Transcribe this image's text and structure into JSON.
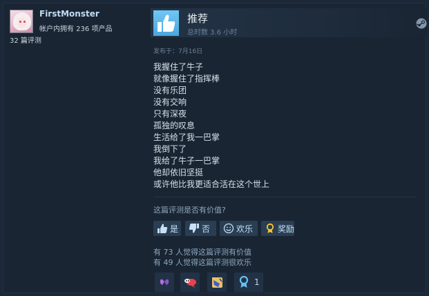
{
  "user": {
    "name": "FirstMonster",
    "products_owned": "帐户内拥有 236 项产品",
    "review_count": "32 篇评测"
  },
  "review": {
    "verdict": "推荐",
    "hours": "总时数 3.6 小时",
    "posted": "发布于：7月16日",
    "lines": [
      "我握住了牛子",
      "就像握住了指挥棒",
      "没有乐团",
      "没有交响",
      "只有深夜",
      "孤独的叹息",
      "生活给了我一巴掌",
      "我倒下了",
      "我给了牛子一巴掌",
      "他却依旧坚挺",
      "或许他比我更适合活在这个世上"
    ],
    "helpful_question": "这篇评测是否有价值?",
    "buttons": {
      "yes": "是",
      "no": "否",
      "funny": "欢乐",
      "award": "奖励"
    },
    "helpful_stat": "有 73 人觉得这篇评测有价值",
    "funny_stat": "有 49 人觉得这篇评测很欢乐",
    "award_count": "1"
  },
  "icons": {
    "verdict": "thumbs-up-icon",
    "platform": "steam-logo-icon",
    "yes": "thumbs-up-icon",
    "no": "thumbs-down-icon",
    "funny": "smiley-icon",
    "award": "award-ribbon-icon"
  },
  "colors": {
    "background": "#1b2838",
    "accent": "#67c1f5",
    "button": "#293e53",
    "award_gold": "#ffc82c"
  }
}
